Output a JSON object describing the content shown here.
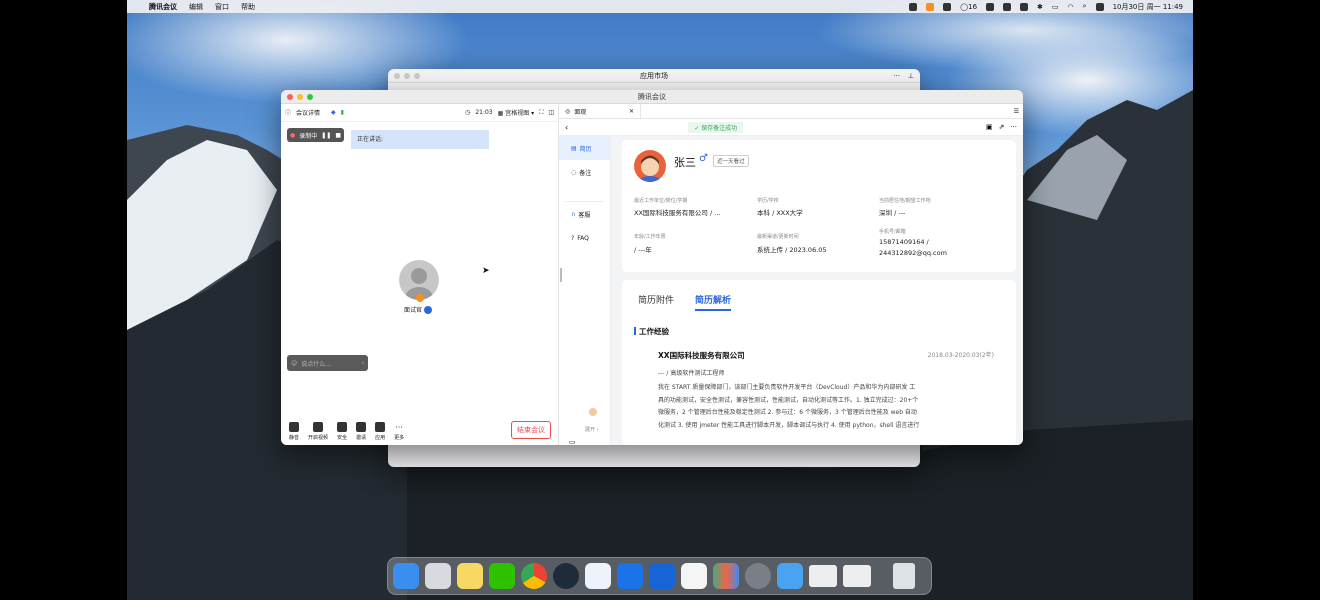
{
  "menubar": {
    "app_name": "腾讯会议",
    "menus": [
      "编辑",
      "窗口",
      "帮助"
    ],
    "status_count": "16",
    "datetime": "10月30日 周一 11:49"
  },
  "back_window": {
    "title": "应用市场"
  },
  "meeting_window": {
    "title": "腾讯会议",
    "toolbar": {
      "details_label": "会议详情",
      "time": "21:03",
      "view_label": "宫格视图"
    },
    "recording_label": "录制中",
    "speaking_label": "正在讲话:",
    "participant_name": "面试官",
    "chat_placeholder": "说点什么...",
    "bottom_buttons": [
      {
        "label": "静音"
      },
      {
        "label": "开启视频"
      },
      {
        "label": "安全"
      },
      {
        "label": "邀请"
      },
      {
        "label": "应用"
      },
      {
        "label": "更多"
      }
    ],
    "end_label": "结束会议"
  },
  "resume_panel": {
    "tab_label": "面观",
    "toast": "保存备注成功",
    "side_items": [
      {
        "label": "简历"
      },
      {
        "label": "备注"
      },
      {
        "label": "客服"
      },
      {
        "label": "FAQ"
      }
    ],
    "candidate": {
      "name": "张三",
      "gender_symbol": "♂",
      "seen_badge": "近一天看过",
      "fields": {
        "work_label": "最近工作单位/岗位/学期",
        "work_value": "XX国际科技服务有限公司 / ...",
        "edu_label": "学历/学校",
        "edu_value": "本科 / XXX大学",
        "loc_label": "当前居住地/期望工作地",
        "loc_value": "深圳 / ---",
        "age_label": "年龄/工作年限",
        "age_value": "/ ---年",
        "channel_label": "最新渠道/更新时间",
        "channel_value": "系统上传 / 2023.06.05",
        "contact_label": "手机号/邮箱",
        "contact_value": "15871409164 /",
        "contact_value2": "244312892@qq.com"
      }
    },
    "tabs2": [
      "简历附件",
      "简历解析"
    ],
    "section_title": "工作经验",
    "job": {
      "company": "XX国际科技服务有限公司",
      "period": "2018.03-2020.03(2年)",
      "role": "--- / 高级软件测试工程师",
      "side_note": "展开",
      "desc_lines": [
        "我在 START 质量保障部门，该部门主要负责软件开发平台（DevCloud）产品和华为内部研发 工",
        "具的功能测试，安全性测试，兼容性测试，性能测试，自动化测试等工作。1. 独立完成过：20+个",
        "微服务，2 个管理后台性能及稳定性测试 2. 参与过：6 个微服务，3 个管理后台性能及 web 自动",
        "化测试 3. 使用 jmeter 性能工具进行脚本开发，脚本调试与执行 4. 使用 python，shell 语言进行"
      ]
    }
  },
  "colors": {
    "accent": "#2a66e0",
    "end": "#e6514e"
  }
}
